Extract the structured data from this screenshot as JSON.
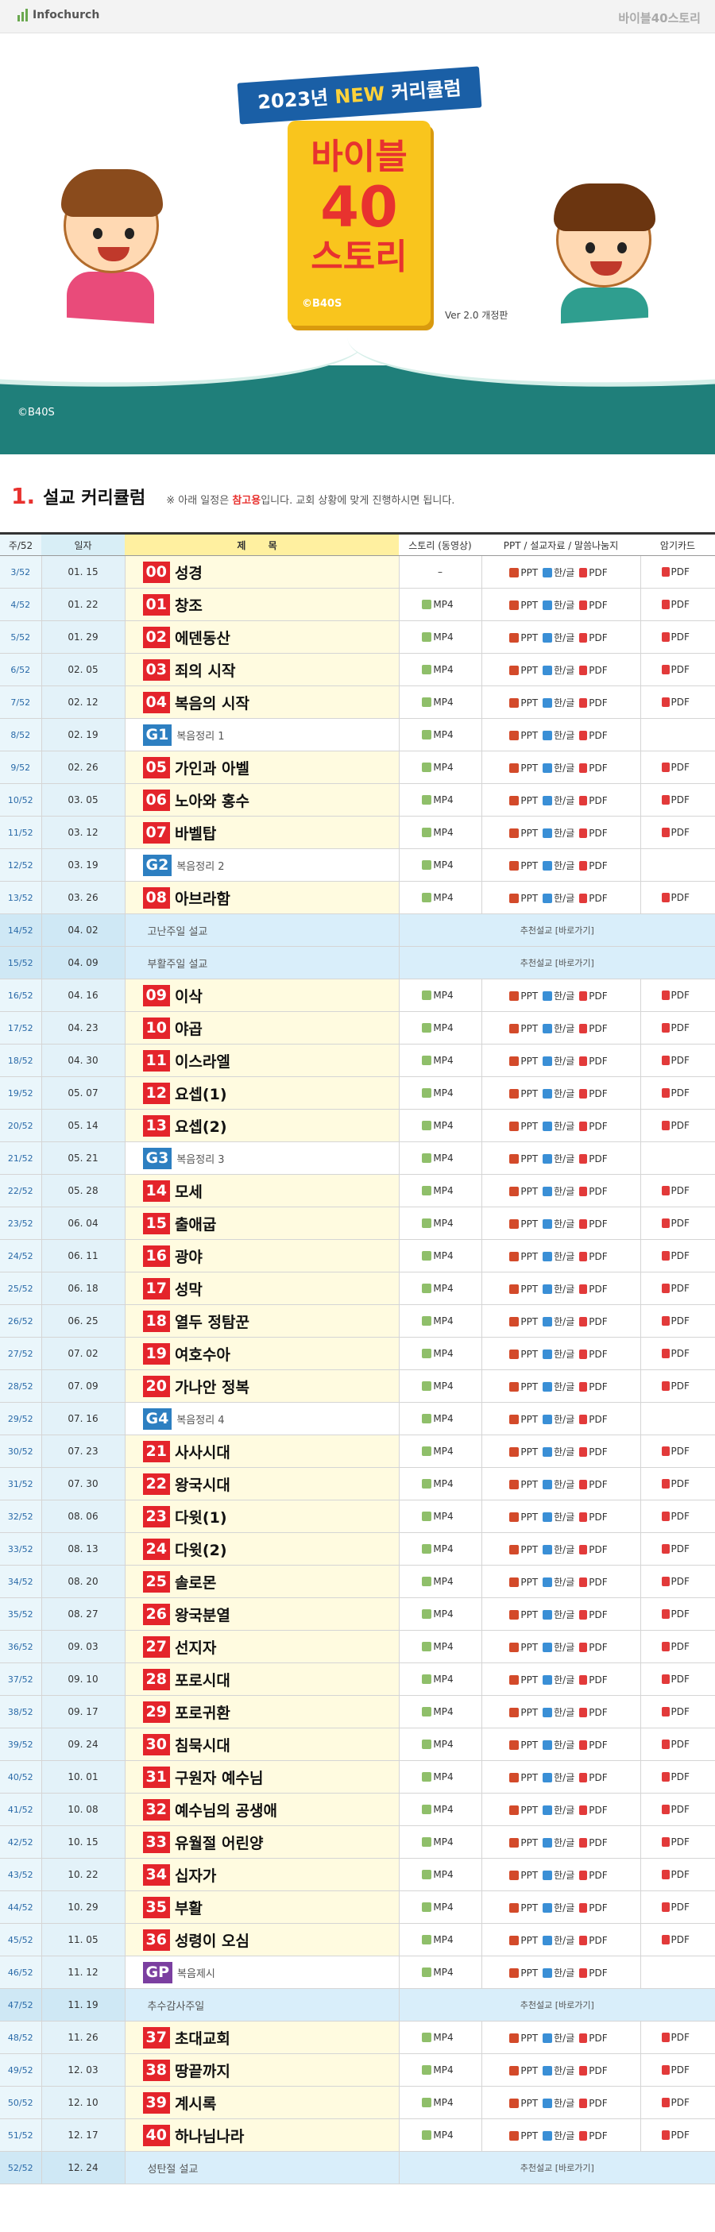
{
  "brand": "Infochurch",
  "site_title": "바이블40스토리",
  "hero": {
    "ribbon_pre": "2023년 ",
    "ribbon_new": "NEW",
    "ribbon_post": " 커리큘럼",
    "book_line1": "바이블",
    "book_line2": "40",
    "book_line3": "스토리",
    "book_copy": "©B40S",
    "version": "Ver 2.0 개정판",
    "footer_copy": "©B40S"
  },
  "section": {
    "number": "1.",
    "title": "설교 커리큘럼",
    "note_pre": "※ 아래 일정은 ",
    "note_em": "참고용",
    "note_post": "입니다. 교회 상황에 맞게 진행하시면 됩니다."
  },
  "columns": {
    "week": "주/52",
    "date": "일자",
    "title": "제  목",
    "media": "스토리 (동영상)",
    "ppt": "PPT / 설교자료 / 말씀나눔지",
    "card": "암기카드"
  },
  "labels": {
    "mp4": "MP4",
    "ppt": "PPT",
    "hwp": "한/글",
    "pdf": "PDF",
    "dash": "–",
    "recommend": "추천설교 [바로가기]"
  },
  "rows": [
    {
      "w": "3/52",
      "d": "01. 15",
      "c": "00",
      "t": "성경",
      "k": "main",
      "m": "dash"
    },
    {
      "w": "4/52",
      "d": "01. 22",
      "c": "01",
      "t": "창조",
      "k": "main"
    },
    {
      "w": "5/52",
      "d": "01. 29",
      "c": "02",
      "t": "에덴동산",
      "k": "main"
    },
    {
      "w": "6/52",
      "d": "02. 05",
      "c": "03",
      "t": "죄의 시작",
      "k": "main"
    },
    {
      "w": "7/52",
      "d": "02. 12",
      "c": "04",
      "t": "복음의 시작",
      "k": "main"
    },
    {
      "w": "8/52",
      "d": "02. 19",
      "c": "G1",
      "t": "복음정리 1",
      "k": "rev"
    },
    {
      "w": "9/52",
      "d": "02. 26",
      "c": "05",
      "t": "가인과 아벨",
      "k": "main"
    },
    {
      "w": "10/52",
      "d": "03. 05",
      "c": "06",
      "t": "노아와 홍수",
      "k": "main"
    },
    {
      "w": "11/52",
      "d": "03. 12",
      "c": "07",
      "t": "바벨탑",
      "k": "main"
    },
    {
      "w": "12/52",
      "d": "03. 19",
      "c": "G2",
      "t": "복음정리 2",
      "k": "rev"
    },
    {
      "w": "13/52",
      "d": "03. 26",
      "c": "08",
      "t": "아브라함",
      "k": "main"
    },
    {
      "w": "14/52",
      "d": "04. 02",
      "c": "",
      "t": "고난주일 설교",
      "k": "spec"
    },
    {
      "w": "15/52",
      "d": "04. 09",
      "c": "",
      "t": "부활주일 설교",
      "k": "spec"
    },
    {
      "w": "16/52",
      "d": "04. 16",
      "c": "09",
      "t": "이삭",
      "k": "main"
    },
    {
      "w": "17/52",
      "d": "04. 23",
      "c": "10",
      "t": "야곱",
      "k": "main"
    },
    {
      "w": "18/52",
      "d": "04. 30",
      "c": "11",
      "t": "이스라엘",
      "k": "main"
    },
    {
      "w": "19/52",
      "d": "05. 07",
      "c": "12",
      "t": "요셉(1)",
      "k": "main"
    },
    {
      "w": "20/52",
      "d": "05. 14",
      "c": "13",
      "t": "요셉(2)",
      "k": "main"
    },
    {
      "w": "21/52",
      "d": "05. 21",
      "c": "G3",
      "t": "복음정리 3",
      "k": "rev"
    },
    {
      "w": "22/52",
      "d": "05. 28",
      "c": "14",
      "t": "모세",
      "k": "main"
    },
    {
      "w": "23/52",
      "d": "06. 04",
      "c": "15",
      "t": "출애굽",
      "k": "main"
    },
    {
      "w": "24/52",
      "d": "06. 11",
      "c": "16",
      "t": "광야",
      "k": "main"
    },
    {
      "w": "25/52",
      "d": "06. 18",
      "c": "17",
      "t": "성막",
      "k": "main"
    },
    {
      "w": "26/52",
      "d": "06. 25",
      "c": "18",
      "t": "열두 정탐꾼",
      "k": "main"
    },
    {
      "w": "27/52",
      "d": "07. 02",
      "c": "19",
      "t": "여호수아",
      "k": "main"
    },
    {
      "w": "28/52",
      "d": "07. 09",
      "c": "20",
      "t": "가나안 정복",
      "k": "main"
    },
    {
      "w": "29/52",
      "d": "07. 16",
      "c": "G4",
      "t": "복음정리 4",
      "k": "rev"
    },
    {
      "w": "30/52",
      "d": "07. 23",
      "c": "21",
      "t": "사사시대",
      "k": "main"
    },
    {
      "w": "31/52",
      "d": "07. 30",
      "c": "22",
      "t": "왕국시대",
      "k": "main"
    },
    {
      "w": "32/52",
      "d": "08. 06",
      "c": "23",
      "t": "다윗(1)",
      "k": "main"
    },
    {
      "w": "33/52",
      "d": "08. 13",
      "c": "24",
      "t": "다윗(2)",
      "k": "main"
    },
    {
      "w": "34/52",
      "d": "08. 20",
      "c": "25",
      "t": "솔로몬",
      "k": "main"
    },
    {
      "w": "35/52",
      "d": "08. 27",
      "c": "26",
      "t": "왕국분열",
      "k": "main"
    },
    {
      "w": "36/52",
      "d": "09. 03",
      "c": "27",
      "t": "선지자",
      "k": "main"
    },
    {
      "w": "37/52",
      "d": "09. 10",
      "c": "28",
      "t": "포로시대",
      "k": "main"
    },
    {
      "w": "38/52",
      "d": "09. 17",
      "c": "29",
      "t": "포로귀환",
      "k": "main"
    },
    {
      "w": "39/52",
      "d": "09. 24",
      "c": "30",
      "t": "침묵시대",
      "k": "main"
    },
    {
      "w": "40/52",
      "d": "10. 01",
      "c": "31",
      "t": "구원자 예수님",
      "k": "main"
    },
    {
      "w": "41/52",
      "d": "10. 08",
      "c": "32",
      "t": "예수님의 공생애",
      "k": "main"
    },
    {
      "w": "42/52",
      "d": "10. 15",
      "c": "33",
      "t": "유월절 어린양",
      "k": "main"
    },
    {
      "w": "43/52",
      "d": "10. 22",
      "c": "34",
      "t": "십자가",
      "k": "main"
    },
    {
      "w": "44/52",
      "d": "10. 29",
      "c": "35",
      "t": "부활",
      "k": "main"
    },
    {
      "w": "45/52",
      "d": "11. 05",
      "c": "36",
      "t": "성령이 오심",
      "k": "main"
    },
    {
      "w": "46/52",
      "d": "11. 12",
      "c": "GP",
      "t": "복음제시",
      "k": "rev"
    },
    {
      "w": "47/52",
      "d": "11. 19",
      "c": "",
      "t": "추수감사주일",
      "k": "spec"
    },
    {
      "w": "48/52",
      "d": "11. 26",
      "c": "37",
      "t": "초대교회",
      "k": "main"
    },
    {
      "w": "49/52",
      "d": "12. 03",
      "c": "38",
      "t": "땅끝까지",
      "k": "main"
    },
    {
      "w": "50/52",
      "d": "12. 10",
      "c": "39",
      "t": "계시록",
      "k": "main"
    },
    {
      "w": "51/52",
      "d": "12. 17",
      "c": "40",
      "t": "하나님나라",
      "k": "main"
    },
    {
      "w": "52/52",
      "d": "12. 24",
      "c": "",
      "t": "성탄절 설교",
      "k": "spec"
    }
  ]
}
